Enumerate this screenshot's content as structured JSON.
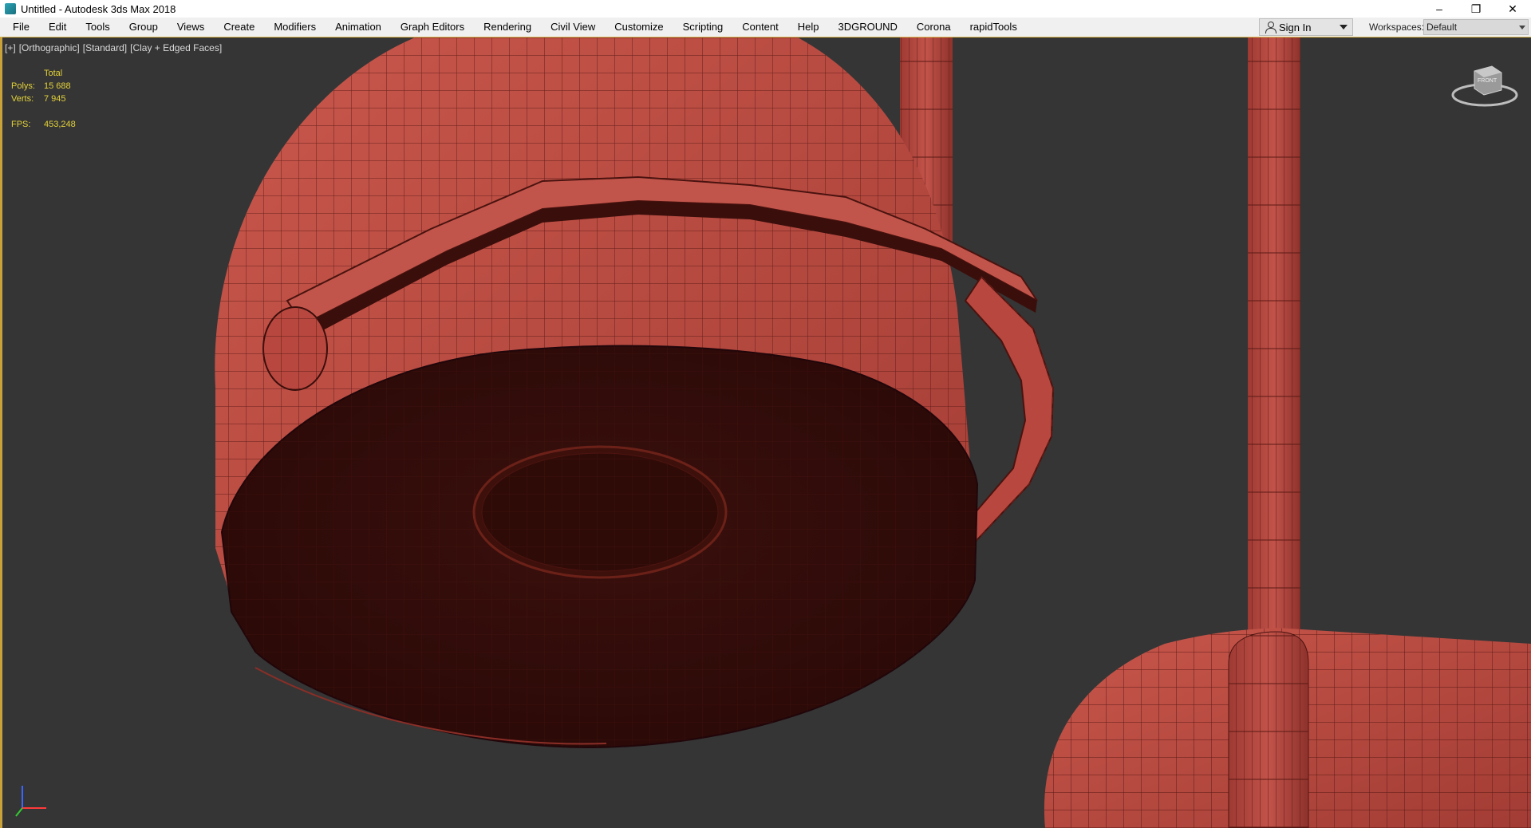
{
  "window": {
    "title": "Untitled - Autodesk 3ds Max 2018",
    "controls": {
      "minimize": "–",
      "restore": "❐",
      "close": "✕"
    }
  },
  "menu": {
    "items": [
      "File",
      "Edit",
      "Tools",
      "Group",
      "Views",
      "Create",
      "Modifiers",
      "Animation",
      "Graph Editors",
      "Rendering",
      "Civil View",
      "Customize",
      "Scripting",
      "Content",
      "Help",
      "3DGROUND",
      "Corona",
      "rapidTools"
    ]
  },
  "account": {
    "sign_in_label": "Sign In"
  },
  "workspaces": {
    "label": "Workspaces:",
    "value": "Default"
  },
  "viewport": {
    "labels": [
      "[+]",
      "[Orthographic]",
      "[Standard]",
      "[Clay + Edged Faces]"
    ],
    "stats": {
      "header": "Total",
      "polys_label": "Polys:",
      "polys": "15 688",
      "verts_label": "Verts:",
      "verts": "7 945",
      "fps_label": "FPS:",
      "fps": "453,248"
    },
    "viewcube_label": "FRONT"
  },
  "colors": {
    "clay": "#b5473f",
    "clay_dark": "#3d100c",
    "viewport_bg": "#353535",
    "stats_text": "#e3d23a"
  }
}
